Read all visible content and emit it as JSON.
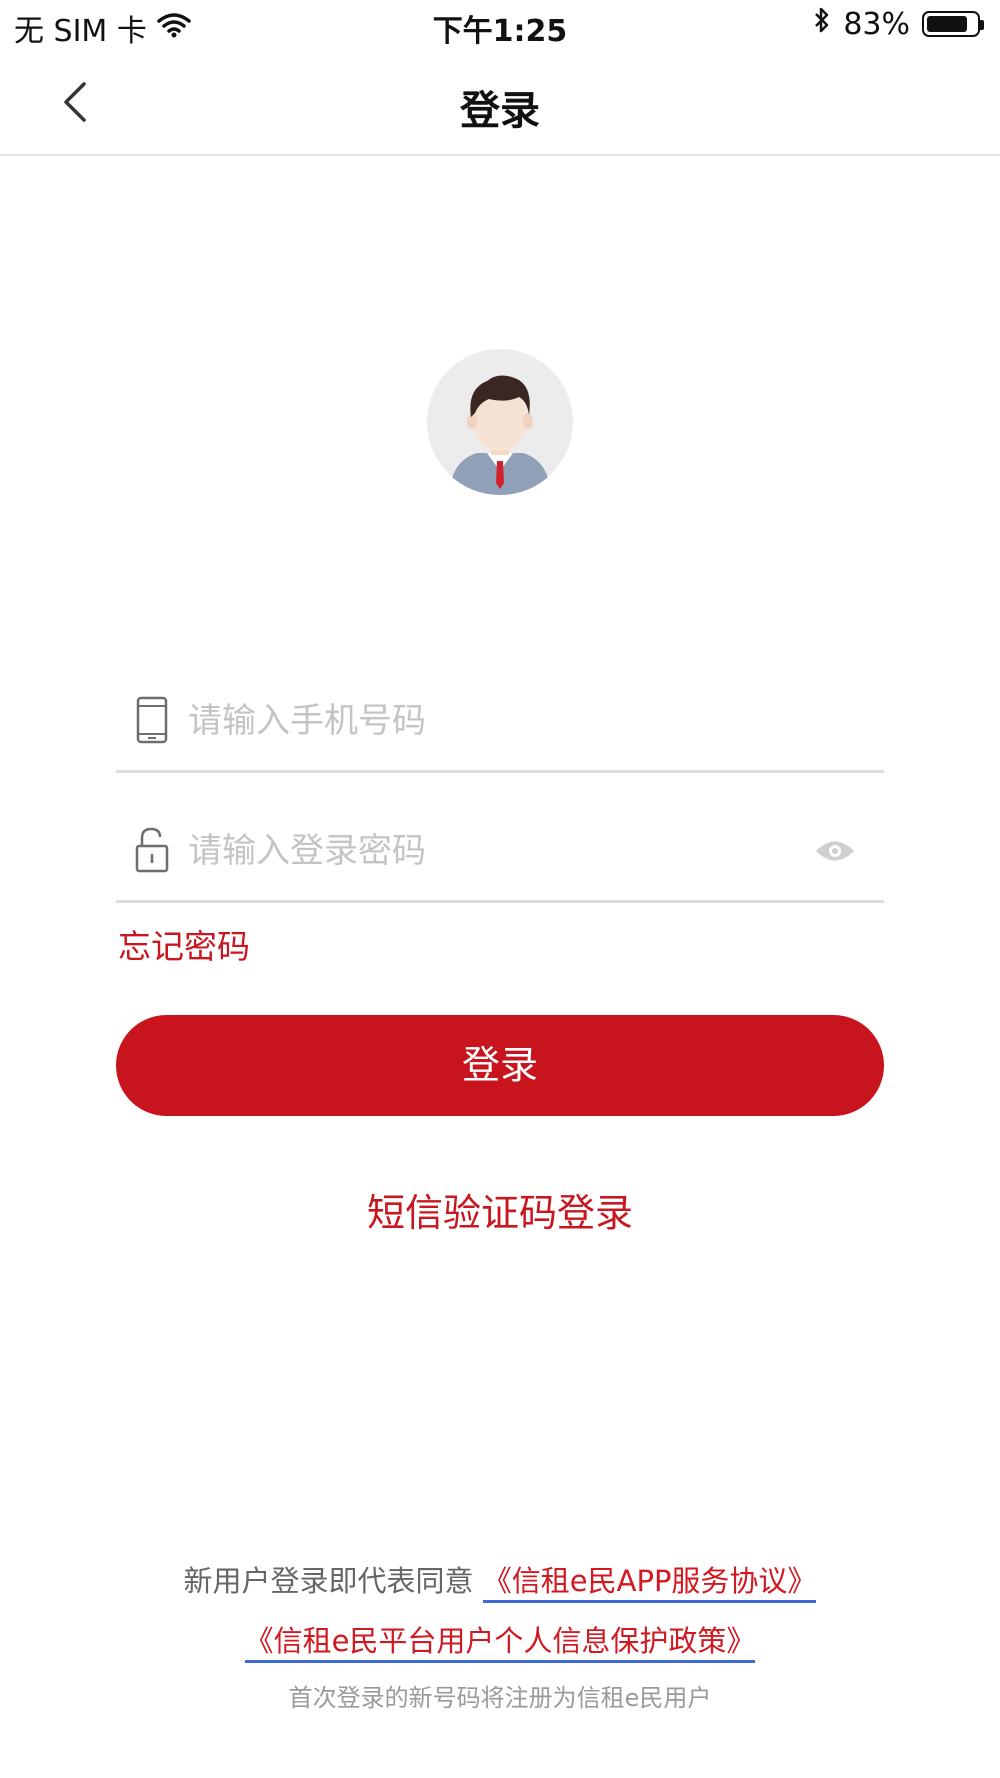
{
  "status_bar": {
    "carrier": "无 SIM 卡",
    "time": "下午1:25",
    "battery": "83%",
    "battery_level": 0.83,
    "wifi_icon": "wifi-icon",
    "bluetooth_icon": "bluetooth-icon"
  },
  "nav": {
    "title": "登录",
    "back_icon": "chevron-left-icon"
  },
  "avatar_icon": "user-avatar-icon",
  "form": {
    "phone_placeholder": "请输入手机号码",
    "phone_value": "",
    "phone_icon": "phone-icon",
    "password_placeholder": "请输入登录密码",
    "password_value": "",
    "password_icon": "unlock-icon",
    "show_password_icon": "eye-icon",
    "forgot_label": "忘记密码",
    "login_label": "登录",
    "sms_login_label": "短信验证码登录"
  },
  "footer": {
    "agree_text": "新用户登录即代表同意",
    "service_agreement": "《信租e民APP服务协议》",
    "privacy_policy": "《信租e民平台用户个人信息保护政策》",
    "note": "首次登录的新号码将注册为信租e民用户"
  },
  "colors": {
    "accent": "#c8141d",
    "link_underline": "#3d6bd6",
    "placeholder": "#c4c4c8",
    "divider": "#dcdcdc"
  }
}
